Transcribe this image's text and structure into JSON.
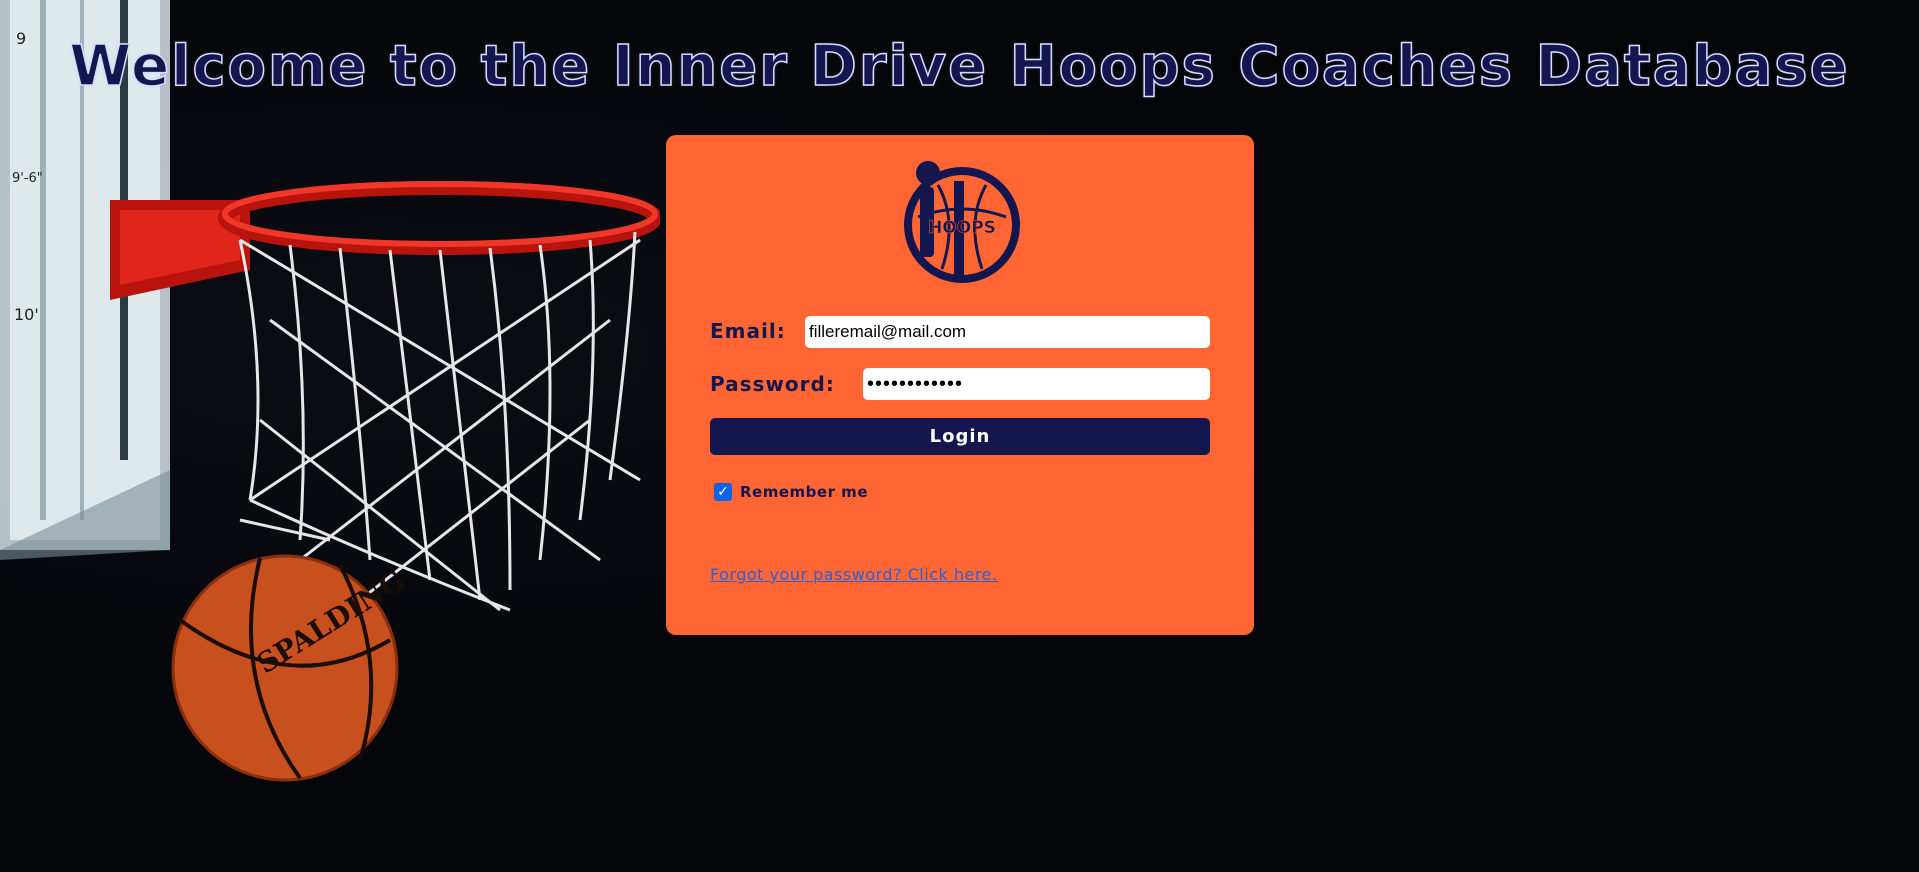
{
  "header": {
    "title": "Welcome to the Inner Drive Hoops Coaches Database"
  },
  "logo": {
    "text": "HOOPS",
    "color": "#14164f"
  },
  "login_form": {
    "email_label": "Email:",
    "email_value": "filleremail@mail.com",
    "password_label": "Password:",
    "password_value": "••••••••••••",
    "login_button_label": "Login",
    "remember_me_label": "Remember me",
    "remember_me_checked": true,
    "forgot_password_link": "Forgot your password? Click here."
  },
  "colors": {
    "background": "#040508",
    "card": "#ff6633",
    "brand_navy": "#14164f",
    "link": "#2b5fd9",
    "checkbox": "#0b63e5"
  },
  "decorations": {
    "backboard_markings": [
      "9",
      "9'-6\"",
      "10'"
    ],
    "ball_brand": "SPALDING"
  }
}
